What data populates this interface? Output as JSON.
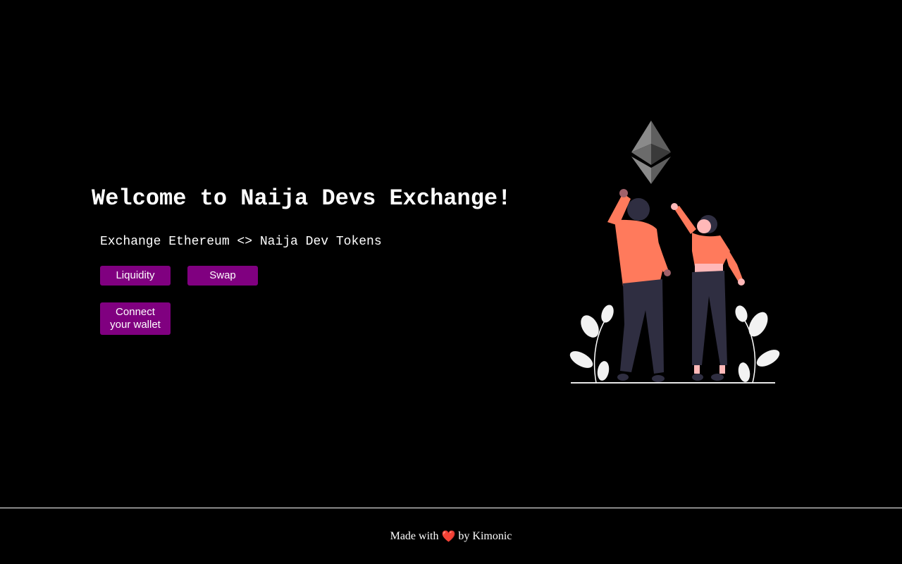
{
  "hero": {
    "title": "Welcome to Naija Devs Exchange!",
    "subtitle": "Exchange Ethereum <> Naija Dev Tokens"
  },
  "buttons": {
    "liquidity": "Liquidity",
    "swap": "Swap",
    "connect_line1": "Connect",
    "connect_line2": "your wallet"
  },
  "illustration": {
    "icon": "ethereum-icon",
    "description_icon": "people-celebrating-illustration"
  },
  "footer": {
    "prefix": "Made with ",
    "heart": "❤️",
    "suffix": " by Kimonic"
  },
  "colors": {
    "background": "#000000",
    "button": "#800080",
    "text": "#ffffff",
    "shirt": "#ff7a5c",
    "pants": "#2f2e41",
    "heart": "#e0262b"
  }
}
